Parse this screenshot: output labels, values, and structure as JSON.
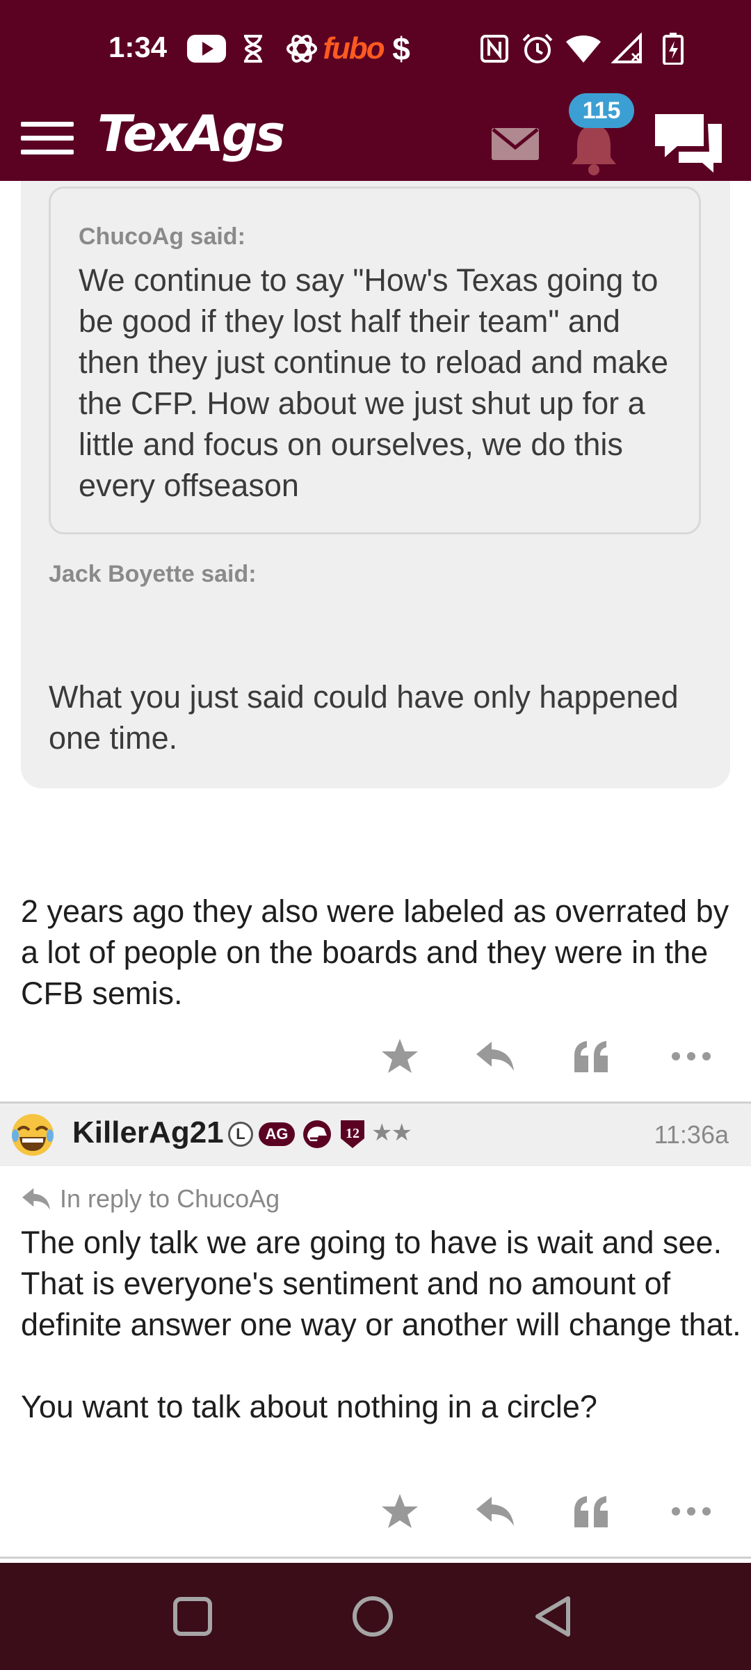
{
  "status_bar": {
    "time": "1:34",
    "fubo_label": "fubo",
    "dollar_label": "$",
    "icons": [
      "youtube-icon",
      "hourglass-icon",
      "openai-icon",
      "fubo-icon",
      "cashapp-icon",
      "nfc-icon",
      "alarm-icon",
      "wifi-icon",
      "signal-icon",
      "battery-charging-icon"
    ]
  },
  "header": {
    "logo": "TexAgs",
    "notification_count": "115",
    "colors": {
      "maroon": "#5b0223",
      "badge_blue": "#3c9fd3"
    }
  },
  "quote_block": {
    "inner": {
      "author_label": "ChucoAg said:",
      "text": "We continue to say \"How's Texas going to be good if they lost half their team\" and then they just continue to reload and make the CFP. How about we just shut up for a little and focus on ourselves, we do this every offseason"
    },
    "outer_author_label": "Jack Boyette said:",
    "outer_text": "What you just said could have only happened one time."
  },
  "post1": {
    "text": "2 years ago they also were labeled as overrated by a lot of people on the boards and they were in the CFB semis."
  },
  "post2": {
    "username": "KillerAg21",
    "badge_l": "L",
    "badge_ag": "AG",
    "badge_12": "12",
    "stars": "★★",
    "time": "11:36a",
    "reply_to": "In reply to ChucoAg",
    "paragraph1": "The only talk we are going to have is wait and see. That is everyone's sentiment and no amount of definite answer one way or another will change that.",
    "paragraph2": "You want to talk about nothing in a circle?"
  },
  "actions": [
    "star-icon",
    "reply-icon",
    "quote-icon",
    "more-icon"
  ],
  "nav_bar": [
    "recents-button",
    "home-button",
    "back-button"
  ]
}
